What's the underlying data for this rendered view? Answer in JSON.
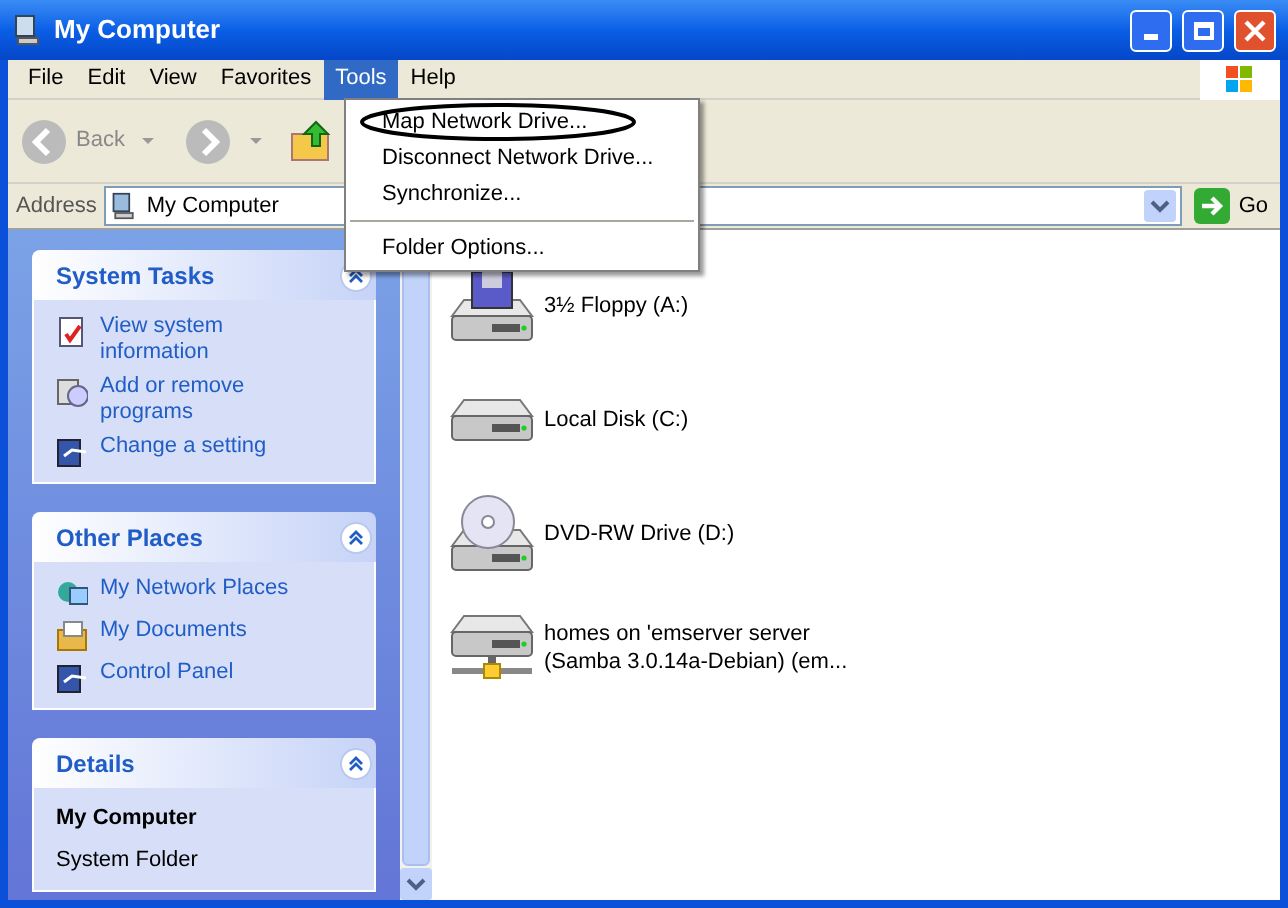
{
  "window": {
    "title": "My Computer"
  },
  "menu": [
    {
      "label": "File",
      "selected": false
    },
    {
      "label": "Edit",
      "selected": false
    },
    {
      "label": "View",
      "selected": false
    },
    {
      "label": "Favorites",
      "selected": false
    },
    {
      "label": "Tools",
      "selected": true
    },
    {
      "label": "Help",
      "selected": false
    }
  ],
  "dropdown": [
    {
      "kind": "item",
      "label": "Map Network Drive...",
      "circled": true
    },
    {
      "kind": "item",
      "label": "Disconnect Network Drive...",
      "circled": false
    },
    {
      "kind": "item",
      "label": "Synchronize...",
      "circled": false
    },
    {
      "kind": "separator"
    },
    {
      "kind": "item",
      "label": "Folder Options...",
      "circled": false
    }
  ],
  "toolbar": {
    "back": "Back"
  },
  "address": {
    "label": "Address",
    "value": "My Computer",
    "go": "Go"
  },
  "panes": [
    {
      "title": "System Tasks",
      "links": [
        {
          "kind": "info",
          "label": "View system information"
        },
        {
          "kind": "programs",
          "label": "Add or remove programs"
        },
        {
          "kind": "panel",
          "label": "Change a setting"
        }
      ]
    },
    {
      "title": "Other Places",
      "links": [
        {
          "kind": "network",
          "label": "My Network Places"
        },
        {
          "kind": "documents",
          "label": "My Documents"
        },
        {
          "kind": "panel",
          "label": "Control Panel"
        }
      ]
    },
    {
      "title": "Details",
      "name": "My Computer",
      "subtitle": "System Folder"
    }
  ],
  "drives": [
    {
      "kind": "floppy",
      "lines": [
        "3½ Floppy (A:)"
      ]
    },
    {
      "kind": "disk",
      "lines": [
        "Local Disk (C:)"
      ]
    },
    {
      "kind": "dvd",
      "lines": [
        "DVD-RW Drive (D:)"
      ]
    },
    {
      "kind": "network",
      "lines": [
        "homes on 'emserver server",
        "(Samba 3.0.14a-Debian) (em..."
      ]
    }
  ]
}
